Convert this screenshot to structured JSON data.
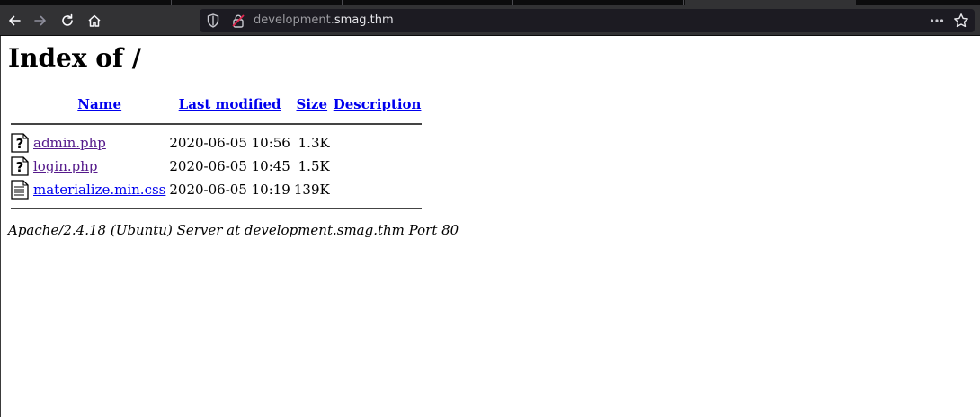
{
  "browser": {
    "url_prefix": "development.",
    "url_host": "smag.thm"
  },
  "page": {
    "title": "Index of /",
    "headers": {
      "name": "Name",
      "last_modified": "Last modified",
      "size": "Size",
      "description": "Description"
    },
    "files": [
      {
        "icon": "unknown-file-icon",
        "name": "admin.php",
        "modified": "2020-06-05 10:56",
        "size": "1.3K",
        "description": ""
      },
      {
        "icon": "unknown-file-icon",
        "name": "login.php",
        "modified": "2020-06-05 10:45",
        "size": "1.5K",
        "description": ""
      },
      {
        "icon": "text-file-icon",
        "name": "materialize.min.css",
        "modified": "2020-06-05 10:19",
        "size": "139K",
        "description": ""
      }
    ],
    "footer": "Apache/2.4.18 (Ubuntu) Server at development.smag.thm Port 80"
  }
}
